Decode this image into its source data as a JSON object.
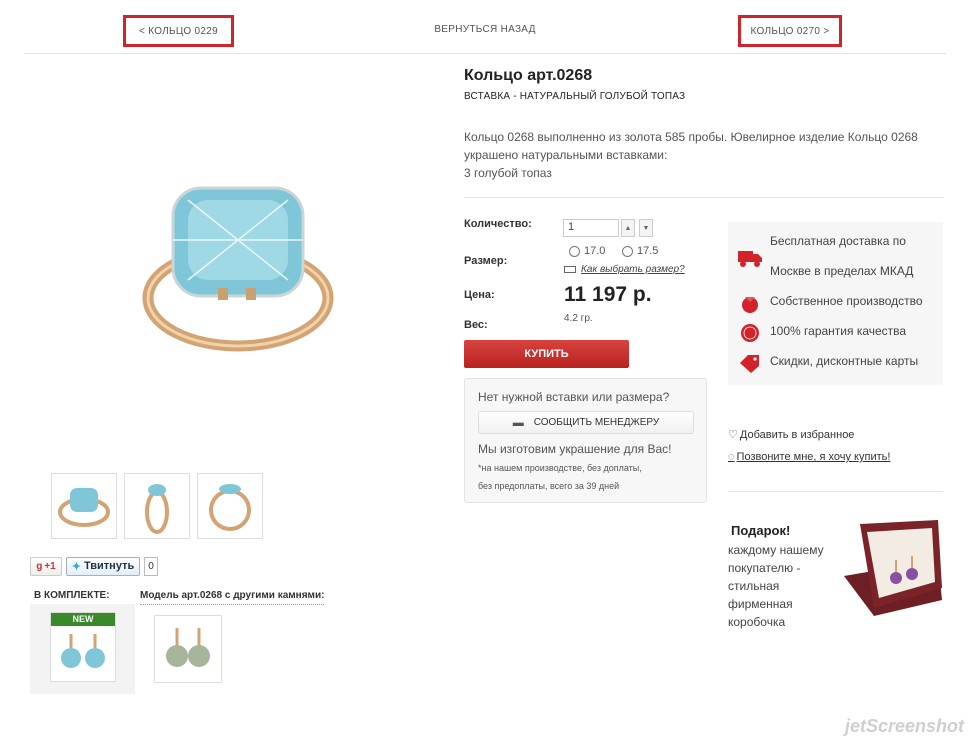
{
  "nav": {
    "prev": "< КОЛЬЦО 0229",
    "back": "ВЕРНУТЬСЯ НАЗАД",
    "next": "КОЛЬЦО 0270 >"
  },
  "product": {
    "title": "Кольцо арт.0268",
    "subtitle": "ВСТАВКА - НАТУРАЛЬНЫЙ ГОЛУБОЙ ТОПАЗ",
    "desc1": "Кольцо 0268 выполненно из золота 585 пробы. Ювелирное изделие Кольцо 0268",
    "desc2": "украшено натуральными вставками:",
    "desc3": "3 голубой топаз"
  },
  "form": {
    "qty_label": "Количество:",
    "qty_value": "1",
    "size_label": "Размер:",
    "sizes": [
      "17.0",
      "17.5"
    ],
    "how_size": "Как выбрать размер?",
    "price_label": "Цена:",
    "price": "11 197 р.",
    "weight_label": "Вес:",
    "weight": "4.2 гр.",
    "buy": "КУПИТЬ"
  },
  "manager": {
    "question": "Нет нужной вставки или размера?",
    "button": "СООБЩИТЬ МЕНЕДЖЕРУ",
    "make": "Мы изготовим украшение для Вас!",
    "note1": "*на нашем производстве, без доплаты,",
    "note2": "без предоплаты, всего за 39 дней"
  },
  "benefits": {
    "delivery1": "Бесплатная доставка по",
    "delivery2": "Москве в пределах МКАД",
    "production": "Собственное производство",
    "guarantee": "100% гарантия качества",
    "discounts": "Скидки, дисконтные карты"
  },
  "actions": {
    "favorite": "Добавить в избранное",
    "callme": "Позвоните мне, я хочу купить!"
  },
  "gift": {
    "title": "Подарок!",
    "line1": "каждому нашему",
    "line2": "покупателю -",
    "line3": "стильная",
    "line4": "фирменная",
    "line5": "коробочка"
  },
  "social": {
    "gplus": "+1",
    "tweet": "Твитнуть",
    "count": "0"
  },
  "sections": {
    "kit": "В КОМПЛЕКТЕ:",
    "kit_badge": "NEW",
    "model": "Модель арт.0268 с другими камнями:"
  },
  "watermark": "jetScreenshot",
  "colors": {
    "accent": "#d2232a",
    "buy": "#c0302c",
    "topaz": "#7fc6d8",
    "gold": "#d4a373"
  }
}
